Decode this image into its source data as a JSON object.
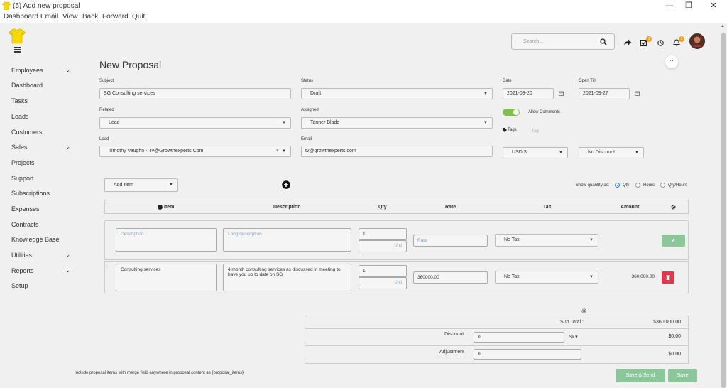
{
  "window": {
    "title": "(5) Add new proposal",
    "minimize": "—",
    "restore": "❐",
    "close": "✕"
  },
  "menu": [
    "Dashboard",
    "Email",
    "View",
    "Back",
    "Forward",
    "Quit"
  ],
  "sidebar": {
    "items": [
      {
        "label": "Employees",
        "chevron": "⌄"
      },
      {
        "label": "Dashboard",
        "chevron": ""
      },
      {
        "label": "Tasks",
        "chevron": ""
      },
      {
        "label": "Leads",
        "chevron": ""
      },
      {
        "label": "Customers",
        "chevron": ""
      },
      {
        "label": "Sales",
        "chevron": "⌄"
      },
      {
        "label": "Projects",
        "chevron": ""
      },
      {
        "label": "Support",
        "chevron": ""
      },
      {
        "label": "Subscriptions",
        "chevron": ""
      },
      {
        "label": "Expenses",
        "chevron": ""
      },
      {
        "label": "Contracts",
        "chevron": ""
      },
      {
        "label": "Knowledge Base",
        "chevron": ""
      },
      {
        "label": "Utilities",
        "chevron": "⌄"
      },
      {
        "label": "Reports",
        "chevron": "⌄"
      },
      {
        "label": "Setup",
        "chevron": ""
      }
    ]
  },
  "header": {
    "search_placeholder": "Search...",
    "todo_badge": "1",
    "notif_badge": "5",
    "collapse": "··"
  },
  "form": {
    "page_title": "New Proposal",
    "subject": {
      "label": "Subject",
      "value": "SG Consulting services"
    },
    "status": {
      "label": "Status",
      "value": "Draft"
    },
    "date": {
      "label": "Date",
      "value": "2021-09-20"
    },
    "open_till": {
      "label": "Open Till",
      "value": "2021-09-27"
    },
    "related": {
      "label": "Related",
      "value": "Lead"
    },
    "assigned": {
      "label": "Assigned",
      "value": "Tanner Blade"
    },
    "allow_comments": "Allow Comments",
    "lead": {
      "label": "Lead",
      "value": "Timothy Vaughn - Tv@Growthexperts.Com",
      "clear": "×"
    },
    "email": {
      "label": "Email",
      "value": "tv@growthexperts.com"
    },
    "tags_label": "Tags",
    "tags_placeholder": "Tag",
    "currency": "USD $",
    "discount_type": "No Discount"
  },
  "items": {
    "add_item": "Add Item",
    "show_quantity_label": "Show quantity as:",
    "qty_options": [
      "Qty",
      "Hours",
      "Qty/Hours"
    ],
    "columns": {
      "item": "Item",
      "description": "Description",
      "qty": "Qty",
      "rate": "Rate",
      "tax": "Tax",
      "amount": "Amount"
    },
    "new_row": {
      "description_placeholder": "Description",
      "long_description_placeholder": "Long description",
      "qty": "1",
      "unit_placeholder": "Unit",
      "rate_placeholder": "Rate",
      "tax": "No Tax"
    },
    "rows": [
      {
        "description": "Consulting services",
        "long_description": "4 month consulting services as discussed in meeting to have you up to date on SG",
        "qty": "1",
        "unit_placeholder": "Unit",
        "rate": "360000,00",
        "tax": "No Tax",
        "amount": "360,000.00"
      }
    ]
  },
  "totals": {
    "marker": "@",
    "subtotal_label": "Sub Total :",
    "subtotal_value": "$360,000.00",
    "discount_label": "Discount",
    "discount_input": "0",
    "discount_type": "%",
    "discount_value": "$0.00",
    "adjustment_label": "Adjustment",
    "adjustment_input": "0",
    "adjustment_value": "$0.00"
  },
  "footer": {
    "note": "Include proposal items with merge field anywhere in proposal content as {proposal_items}",
    "save_send": "Save & Send",
    "save": "Save"
  },
  "colors": {
    "green": "#8cc79b",
    "red": "#e0394d",
    "toggle": "#7fbf4d",
    "badge": "#f0a020",
    "logo": "#f5d800"
  }
}
